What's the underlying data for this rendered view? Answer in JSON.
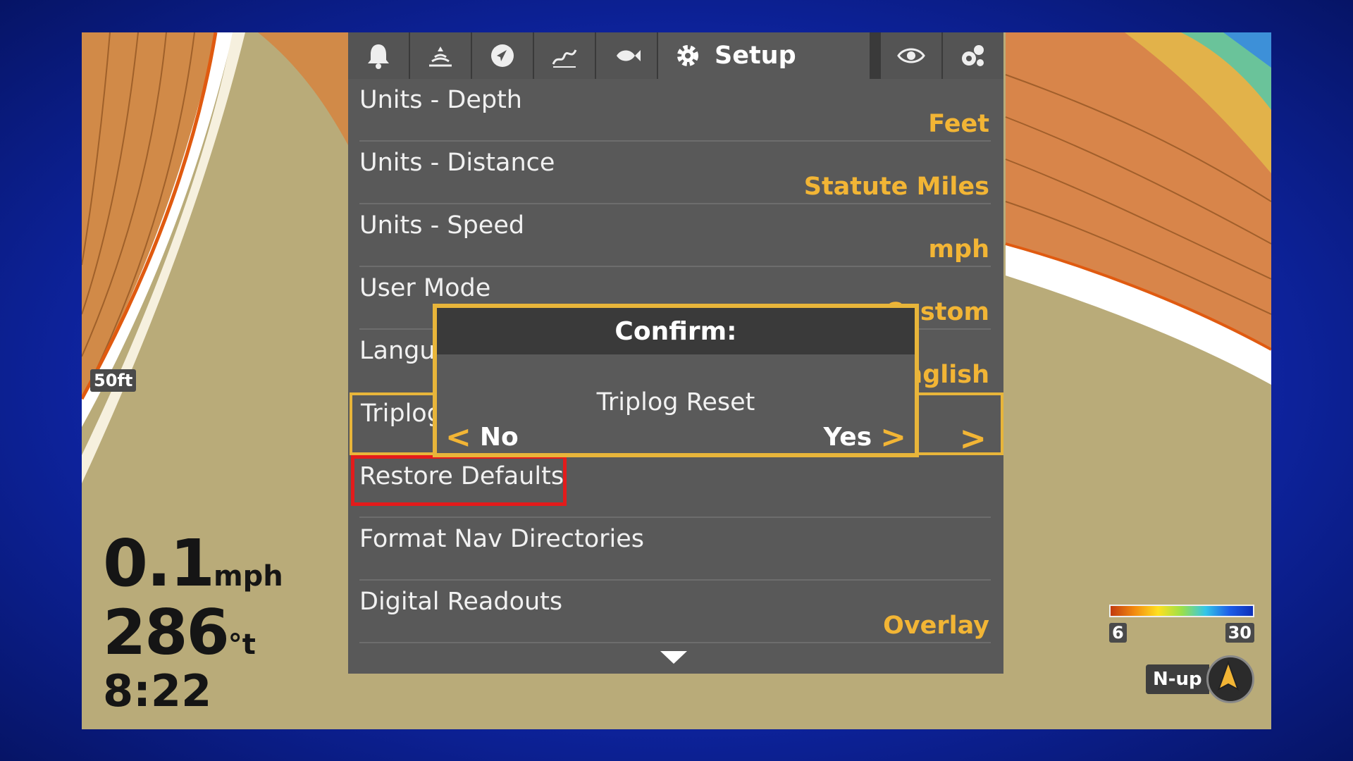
{
  "map": {
    "scale_label": "50ft",
    "speed": {
      "value": "0.1",
      "unit": "mph"
    },
    "heading": {
      "value": "286",
      "unit": "°t"
    },
    "time": "8:22",
    "legend": {
      "min": "6",
      "max": "30"
    },
    "orientation": "N-up",
    "colors": {
      "land": "#b9ab79",
      "contour": "#d98a45",
      "background": "#0f26a8"
    }
  },
  "menu": {
    "tabs": [
      {
        "icon": "alarm-bell-icon"
      },
      {
        "icon": "sonar-icon"
      },
      {
        "icon": "navigation-icon"
      },
      {
        "icon": "chart-icon"
      },
      {
        "icon": "fish-icon"
      },
      {
        "icon": "gear-icon",
        "label": "Setup"
      },
      {
        "icon": "eye-icon"
      },
      {
        "icon": "accessories-icon"
      }
    ],
    "rows": [
      {
        "label": "Units - Depth",
        "value": "Feet"
      },
      {
        "label": "Units - Distance",
        "value": "Statute Miles"
      },
      {
        "label": "Units - Speed",
        "value": "mph"
      },
      {
        "label": "User Mode",
        "value": "Custom"
      },
      {
        "label": "Language",
        "value": "English"
      },
      {
        "label": "Triplog",
        "value": ">"
      },
      {
        "label": "Restore Defaults",
        "value": ""
      },
      {
        "label": "Format Nav Directories",
        "value": ""
      },
      {
        "label": "Digital Readouts",
        "value": "Overlay"
      }
    ],
    "accent_color": "#f2b535"
  },
  "dialog": {
    "title": "Confirm:",
    "message": "Triplog Reset",
    "no_label": "No",
    "yes_label": "Yes"
  }
}
